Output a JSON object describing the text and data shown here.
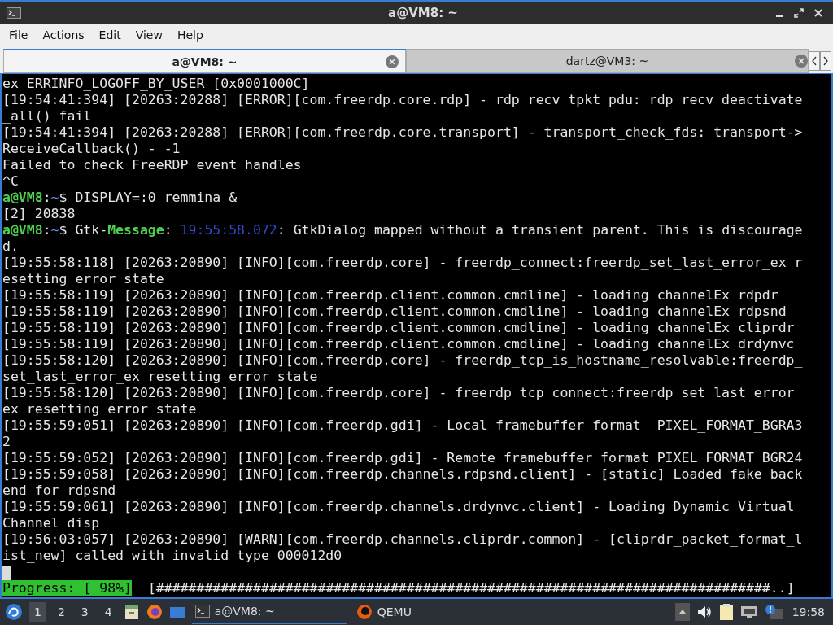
{
  "window": {
    "title": "a@VM8: ~"
  },
  "menu": [
    "File",
    "Actions",
    "Edit",
    "View",
    "Help"
  ],
  "tabs": [
    {
      "label": "a@VM8: ~",
      "selected": true
    },
    {
      "label": "dartz@VM3: ~",
      "selected": false
    }
  ],
  "terminal": {
    "lines": [
      [
        {
          "kind": "plain",
          "text": "ex ERRINFO_LOGOFF_BY_USER [0x0001000C]"
        }
      ],
      [
        {
          "kind": "plain",
          "text": "[19:54:41:394] [20263:20288] [ERROR][com.freerdp.core.rdp] - rdp_recv_tpkt_pdu: rdp_recv_deactivate"
        }
      ],
      [
        {
          "kind": "plain",
          "text": "_all() fail"
        }
      ],
      [
        {
          "kind": "plain",
          "text": "[19:54:41:394] [20263:20288] [ERROR][com.freerdp.core.transport] - transport_check_fds: transport->"
        }
      ],
      [
        {
          "kind": "plain",
          "text": "ReceiveCallback() - -1"
        }
      ],
      [
        {
          "kind": "plain",
          "text": "Failed to check FreeRDP event handles"
        }
      ],
      [
        {
          "kind": "plain",
          "text": "^C"
        }
      ],
      [
        {
          "kind": "user",
          "text": "a@VM8"
        },
        {
          "kind": "plain",
          "text": ":"
        },
        {
          "kind": "path",
          "text": "~"
        },
        {
          "kind": "plain",
          "text": "$ DISPLAY=:0 remmina &"
        }
      ],
      [
        {
          "kind": "plain",
          "text": "[2] 20838"
        }
      ],
      [
        {
          "kind": "user",
          "text": "a@VM8"
        },
        {
          "kind": "plain",
          "text": ":"
        },
        {
          "kind": "path",
          "text": "~"
        },
        {
          "kind": "plain",
          "text": "$ Gtk-"
        },
        {
          "kind": "label",
          "text": "Message"
        },
        {
          "kind": "plain",
          "text": ": "
        },
        {
          "kind": "time",
          "text": "19:55:58.072"
        },
        {
          "kind": "plain",
          "text": ": GtkDialog mapped without a transient parent. This is discourage"
        }
      ],
      [
        {
          "kind": "plain",
          "text": "d."
        }
      ],
      [
        {
          "kind": "plain",
          "text": "[19:55:58:118] [20263:20890] [INFO][com.freerdp.core] - freerdp_connect:freerdp_set_last_error_ex r"
        }
      ],
      [
        {
          "kind": "plain",
          "text": "esetting error state"
        }
      ],
      [
        {
          "kind": "plain",
          "text": "[19:55:58:119] [20263:20890] [INFO][com.freerdp.client.common.cmdline] - loading channelEx rdpdr"
        }
      ],
      [
        {
          "kind": "plain",
          "text": "[19:55:58:119] [20263:20890] [INFO][com.freerdp.client.common.cmdline] - loading channelEx rdpsnd"
        }
      ],
      [
        {
          "kind": "plain",
          "text": "[19:55:58:119] [20263:20890] [INFO][com.freerdp.client.common.cmdline] - loading channelEx cliprdr"
        }
      ],
      [
        {
          "kind": "plain",
          "text": "[19:55:58:119] [20263:20890] [INFO][com.freerdp.client.common.cmdline] - loading channelEx drdynvc"
        }
      ],
      [
        {
          "kind": "plain",
          "text": "[19:55:58:120] [20263:20890] [INFO][com.freerdp.core] - freerdp_tcp_is_hostname_resolvable:freerdp_"
        }
      ],
      [
        {
          "kind": "plain",
          "text": "set_last_error_ex resetting error state"
        }
      ],
      [
        {
          "kind": "plain",
          "text": "[19:55:58:120] [20263:20890] [INFO][com.freerdp.core] - freerdp_tcp_connect:freerdp_set_last_error_"
        }
      ],
      [
        {
          "kind": "plain",
          "text": "ex resetting error state"
        }
      ],
      [
        {
          "kind": "plain",
          "text": "[19:55:59:051] [20263:20890] [INFO][com.freerdp.gdi] - Local framebuffer format  PIXEL_FORMAT_BGRA3"
        }
      ],
      [
        {
          "kind": "plain",
          "text": "2"
        }
      ],
      [
        {
          "kind": "plain",
          "text": "[19:55:59:052] [20263:20890] [INFO][com.freerdp.gdi] - Remote framebuffer format PIXEL_FORMAT_BGR24"
        }
      ],
      [
        {
          "kind": "plain",
          "text": "[19:55:59:058] [20263:20890] [INFO][com.freerdp.channels.rdpsnd.client] - [static] Loaded fake back"
        }
      ],
      [
        {
          "kind": "plain",
          "text": "end for rdpsnd"
        }
      ],
      [
        {
          "kind": "plain",
          "text": "[19:55:59:061] [20263:20890] [INFO][com.freerdp.channels.drdynvc.client] - Loading Dynamic Virtual"
        }
      ],
      [
        {
          "kind": "plain",
          "text": "Channel disp"
        }
      ],
      [
        {
          "kind": "plain",
          "text": "[19:56:03:057] [20263:20890] [WARN][com.freerdp.channels.cliprdr.common] - [cliprdr_packet_format_l"
        }
      ],
      [
        {
          "kind": "plain",
          "text": "ist_new] called with invalid type 000012d0"
        }
      ]
    ],
    "progress": {
      "label": "Progress: [ 98%]",
      "bar": "[############################################################################..]"
    }
  },
  "taskbar": {
    "workspaces": [
      {
        "label": "1",
        "selected": true
      },
      {
        "label": "2",
        "selected": false
      },
      {
        "label": "3",
        "selected": false
      },
      {
        "label": "4",
        "selected": false
      }
    ],
    "tasks": [
      {
        "label": "a@VM8: ~",
        "kind": "terminal",
        "selected": true
      },
      {
        "label": "QEMU",
        "kind": "qemu",
        "selected": false
      }
    ],
    "clock": "19:58"
  }
}
